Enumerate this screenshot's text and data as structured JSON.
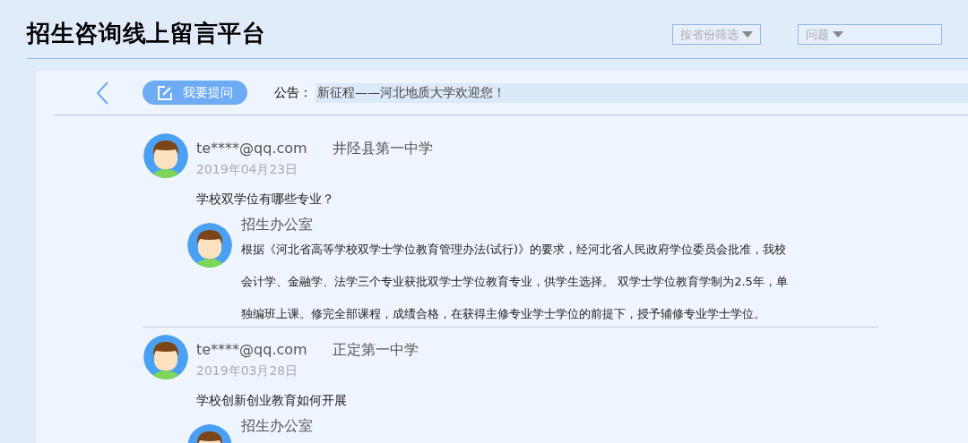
{
  "header": {
    "title": "招生咨询线上留言平台",
    "filters": [
      {
        "label": "按省份筛选",
        "kind": "short"
      },
      {
        "label": "问题",
        "kind": "wide"
      }
    ]
  },
  "toolbar": {
    "ask_button": "我要提问",
    "notice_label": "公告：",
    "notice": "新征程——河北地质大学欢迎您！"
  },
  "messages": [
    {
      "user": "te****@qq.com",
      "school": "井陉县第一中学",
      "date": "2019年04月23日",
      "question": "学校双学位有哪些专业？",
      "reply": {
        "author": "招生办公室",
        "lines": [
          "根据《河北省高等学校双学士学位教育管理办法(试行)》的要求，经河北省人民政府学位委员会批准，我校",
          "会计学、金融学、法学三个专业获批双学士学位教育专业，供学生选择。 双学士学位教育学制为2.5年，单",
          "独编班上课。修完全部课程，成绩合格，在获得主修专业学士学位的前提下，授予辅修专业学士学位。"
        ]
      }
    },
    {
      "user": "te****@qq.com",
      "school": "正定第一中学",
      "date": "2019年03月28日",
      "question": "学校创新创业教育如何开展",
      "reply": {
        "author": "招生办公室"
      }
    }
  ]
}
